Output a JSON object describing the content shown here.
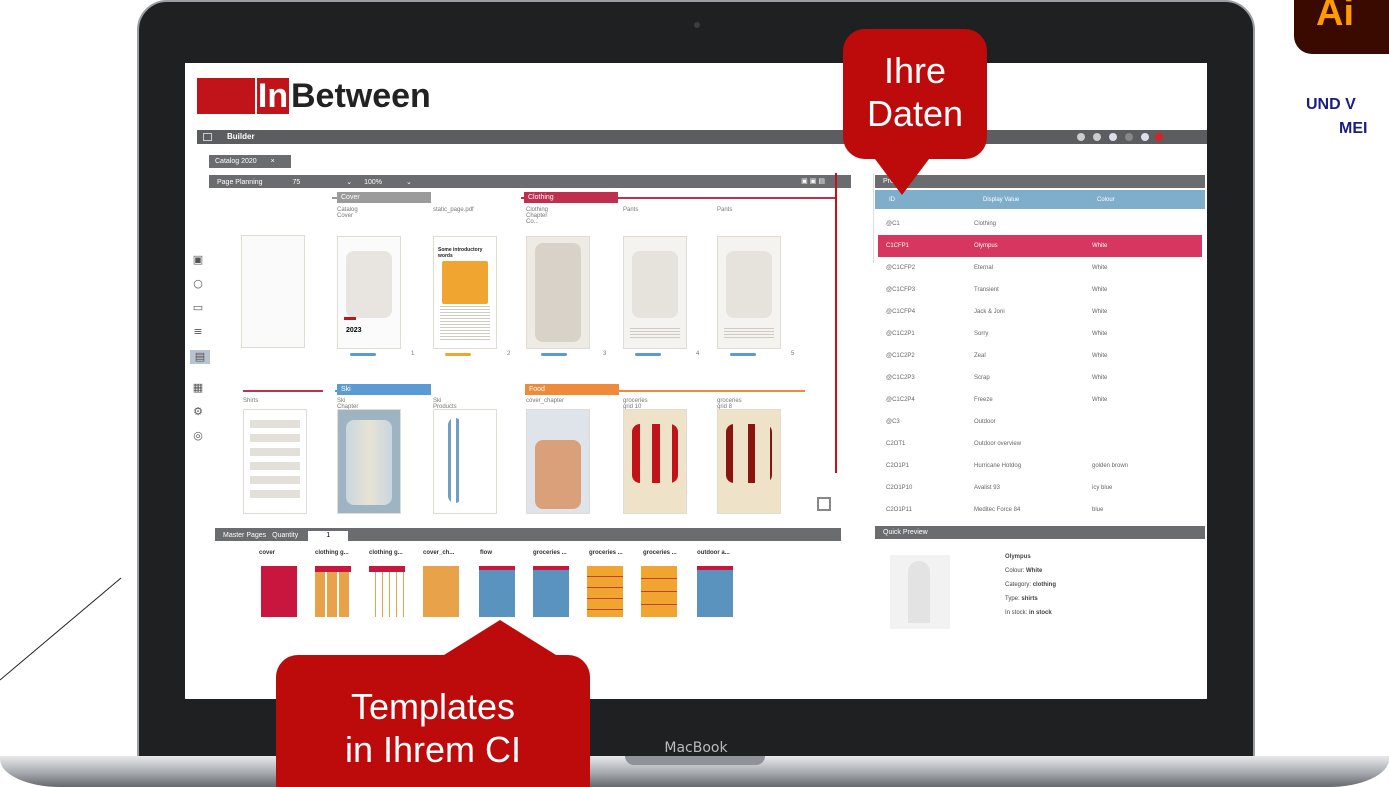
{
  "app": {
    "logo_prefix": "In",
    "logo_suffix": "Between",
    "menu_label": "Builder",
    "doc_tab": "Catalog 2020",
    "doc_tab_close": "×",
    "device_label": "MacBook"
  },
  "page_planning": {
    "title": "Page Planning",
    "zoom1": "75",
    "zoom2": "100%",
    "row1": {
      "groups": [
        {
          "label": "Cover",
          "color": "#9b9b9b"
        },
        {
          "label": "Clothing",
          "color": "#c0304e"
        }
      ],
      "pages": [
        "Catalog Cover",
        "static_page.pdf",
        "Clothing Chapter Co...",
        "Pants",
        "Pants"
      ],
      "counts": [
        "1",
        "2",
        "3",
        "4",
        "5"
      ]
    },
    "row2": {
      "groups": [
        {
          "label": "Ski",
          "color": "#5a9bd5"
        },
        {
          "label": "Food",
          "color": "#ee8a3a"
        }
      ],
      "pages": [
        "Shirts",
        "Ski Chapter Cover",
        "Ski Products",
        "cover_chapter",
        "groceries grid 10",
        "groceries grid 8"
      ]
    },
    "thumb_text": "Some introductory words",
    "thumb_year": "2023"
  },
  "products": {
    "title": "Products",
    "columns": [
      "ID",
      "Display Value",
      "Colour"
    ],
    "rows": [
      {
        "id": "@C1",
        "name": "Clothing",
        "colour": "",
        "selected": false
      },
      {
        "id": "C1CFP1",
        "name": "Olympus",
        "colour": "White",
        "selected": true
      },
      {
        "id": "@C1CFP2",
        "name": "Eternal",
        "colour": "White",
        "selected": false
      },
      {
        "id": "@C1CFP3",
        "name": "Transient",
        "colour": "White",
        "selected": false
      },
      {
        "id": "@C1CFP4",
        "name": "Jack & Joni",
        "colour": "White",
        "selected": false
      },
      {
        "id": "@C1C2P1",
        "name": "Sorry",
        "colour": "White",
        "selected": false
      },
      {
        "id": "@C1C2P2",
        "name": "Zeal",
        "colour": "White",
        "selected": false
      },
      {
        "id": "@C1C2P3",
        "name": "Scrap",
        "colour": "White",
        "selected": false
      },
      {
        "id": "@C1C2P4",
        "name": "Freeze",
        "colour": "White",
        "selected": false
      },
      {
        "id": "@C3",
        "name": "Outdoor",
        "colour": "",
        "selected": false
      },
      {
        "id": "C2OT1",
        "name": "Outdoor overview",
        "colour": "",
        "selected": false
      },
      {
        "id": "C2O1P1",
        "name": "Hurricane Hotdog",
        "colour": "golden brown",
        "selected": false
      },
      {
        "id": "C2O1P10",
        "name": "Avalist 93",
        "colour": "icy blue",
        "selected": false
      },
      {
        "id": "C2O1P11",
        "name": "Meditec Force 84",
        "colour": "blue",
        "selected": false
      }
    ]
  },
  "quick_preview": {
    "title": "Quick Preview",
    "name": "Olympus",
    "colour_label": "Colour:",
    "colour": "White",
    "category_label": "Category:",
    "category": "clothing",
    "type_label": "Type:",
    "type": "shirts",
    "stock_label": "In stock:",
    "stock": "in stock"
  },
  "master_pages": {
    "title": "Master Pages",
    "quantity_label": "Quantity",
    "quantity": "1",
    "items": [
      "cover",
      "clothing g...",
      "clothing g...",
      "cover_ch...",
      "flow",
      "groceries ...",
      "groceries ...",
      "groceries ...",
      "outdoor a..."
    ]
  },
  "callouts": {
    "data_line1": "Ihre",
    "data_line2": "Daten",
    "templates_line1": "Templates",
    "templates_line2": "in Ihrem CI"
  },
  "side": {
    "badge": "Ai",
    "line1": "UND V",
    "line2": "MEI"
  }
}
